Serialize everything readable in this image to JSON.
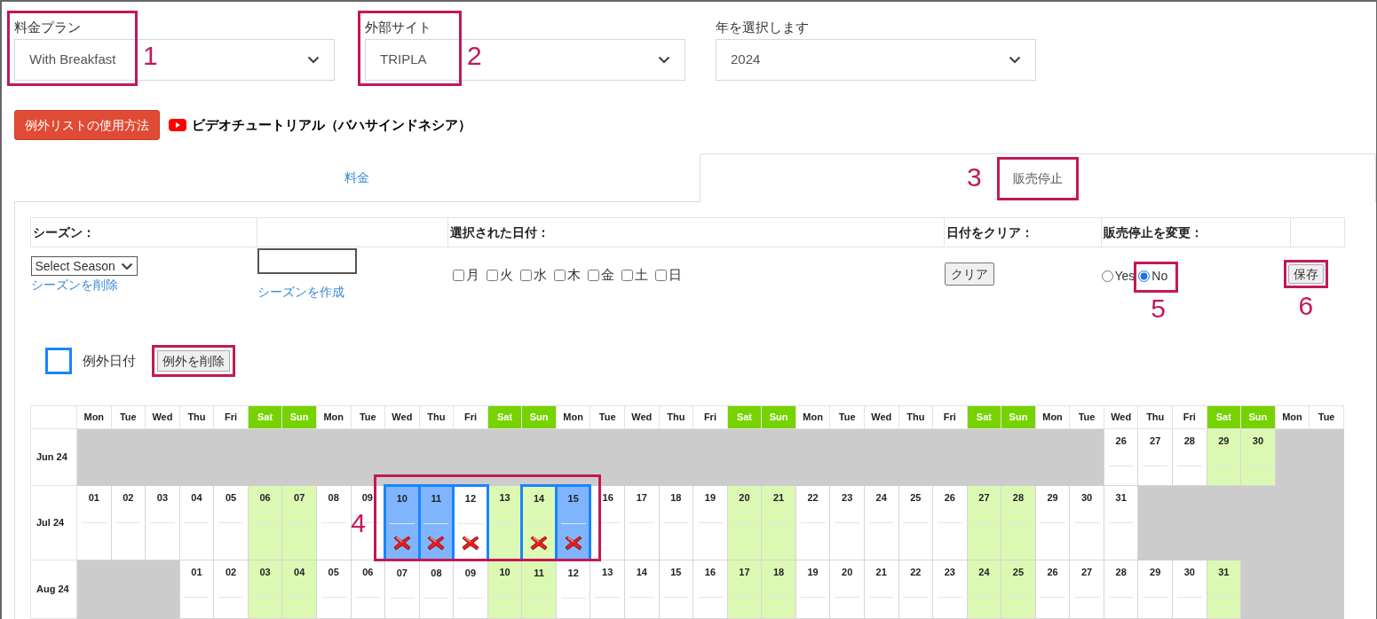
{
  "filters": [
    {
      "label": "料金プラン",
      "value": "With Breakfast",
      "callout": "1"
    },
    {
      "label": "外部サイト",
      "value": "TRIPLA",
      "callout": "2"
    },
    {
      "label": "年を選択します",
      "value": "2024"
    }
  ],
  "help_button": "例外リストの使用方法",
  "video_link": "ビデオチュートリアル（バハサインドネシア）",
  "tabs": [
    {
      "label": "料金",
      "selected": false
    },
    {
      "label": "販売停止",
      "selected": true,
      "callout": "3"
    }
  ],
  "season": {
    "header": "シーズン：",
    "select": "Select Season",
    "delete_link": "シーズンを削除",
    "create_link": "シーズンを作成"
  },
  "dates": {
    "header": "選択された日付：",
    "weekdays": [
      {
        "label": "月",
        "checked": false
      },
      {
        "label": "火",
        "checked": false
      },
      {
        "label": "水",
        "checked": false
      },
      {
        "label": "木",
        "checked": false
      },
      {
        "label": "金",
        "checked": false
      },
      {
        "label": "土",
        "checked": false
      },
      {
        "label": "日",
        "checked": false
      }
    ]
  },
  "clear": {
    "header": "日付をクリア：",
    "button": "クリア"
  },
  "stop_sale": {
    "header": "販売停止を変更：",
    "options": [
      {
        "label": "Yes",
        "selected": false
      },
      {
        "label": "No",
        "selected": true,
        "callout": "5"
      }
    ]
  },
  "save": {
    "label": "保存",
    "callout": "6"
  },
  "legend": {
    "label": "例外日付",
    "button": "例外を削除",
    "framed": true
  },
  "calendar": {
    "callout": "4",
    "columns": [
      {
        "label": "Mon",
        "weekend": false
      },
      {
        "label": "Tue",
        "weekend": false
      },
      {
        "label": "Wed",
        "weekend": false
      },
      {
        "label": "Thu",
        "weekend": false
      },
      {
        "label": "Fri",
        "weekend": false
      },
      {
        "label": "Sat",
        "weekend": true
      },
      {
        "label": "Sun",
        "weekend": true
      },
      {
        "label": "Mon",
        "weekend": false
      },
      {
        "label": "Tue",
        "weekend": false
      },
      {
        "label": "Wed",
        "weekend": false
      },
      {
        "label": "Thu",
        "weekend": false
      },
      {
        "label": "Fri",
        "weekend": false
      },
      {
        "label": "Sat",
        "weekend": true
      },
      {
        "label": "Sun",
        "weekend": true
      },
      {
        "label": "Mon",
        "weekend": false
      },
      {
        "label": "Tue",
        "weekend": false
      },
      {
        "label": "Wed",
        "weekend": false
      },
      {
        "label": "Thu",
        "weekend": false
      },
      {
        "label": "Fri",
        "weekend": false
      },
      {
        "label": "Sat",
        "weekend": true
      },
      {
        "label": "Sun",
        "weekend": true
      },
      {
        "label": "Mon",
        "weekend": false
      },
      {
        "label": "Tue",
        "weekend": false
      },
      {
        "label": "Wed",
        "weekend": false
      },
      {
        "label": "Thu",
        "weekend": false
      },
      {
        "label": "Fri",
        "weekend": false
      },
      {
        "label": "Sat",
        "weekend": true
      },
      {
        "label": "Sun",
        "weekend": true
      },
      {
        "label": "Mon",
        "weekend": false
      },
      {
        "label": "Tue",
        "weekend": false
      },
      {
        "label": "Wed",
        "weekend": false
      },
      {
        "label": "Thu",
        "weekend": false
      },
      {
        "label": "Fri",
        "weekend": false
      },
      {
        "label": "Sat",
        "weekend": true
      },
      {
        "label": "Sun",
        "weekend": true
      },
      {
        "label": "Mon",
        "weekend": false
      },
      {
        "label": "Tue",
        "weekend": false
      }
    ],
    "months": [
      {
        "label": "Jun 24",
        "cells": [
          {
            "kind": "blank"
          },
          {
            "kind": "blank"
          },
          {
            "kind": "blank"
          },
          {
            "kind": "blank"
          },
          {
            "kind": "blank"
          },
          {
            "kind": "blank"
          },
          {
            "kind": "blank"
          },
          {
            "kind": "blank"
          },
          {
            "kind": "blank"
          },
          {
            "kind": "blank"
          },
          {
            "kind": "blank"
          },
          {
            "kind": "blank"
          },
          {
            "kind": "blank"
          },
          {
            "kind": "blank"
          },
          {
            "kind": "blank"
          },
          {
            "kind": "blank"
          },
          {
            "kind": "blank"
          },
          {
            "kind": "blank"
          },
          {
            "kind": "blank"
          },
          {
            "kind": "blank"
          },
          {
            "kind": "blank"
          },
          {
            "kind": "blank"
          },
          {
            "kind": "blank"
          },
          {
            "kind": "blank"
          },
          {
            "kind": "blank"
          },
          {
            "kind": "blank"
          },
          {
            "kind": "blank"
          },
          {
            "kind": "blank"
          },
          {
            "kind": "blank"
          },
          {
            "kind": "blank"
          },
          {
            "kind": "day",
            "day": "26",
            "selected": false,
            "exception": false,
            "stop_sale": false
          },
          {
            "kind": "day",
            "day": "27",
            "selected": false,
            "exception": false,
            "stop_sale": false
          },
          {
            "kind": "day",
            "day": "28",
            "selected": false,
            "exception": false,
            "stop_sale": false
          },
          {
            "kind": "day",
            "day": "29",
            "selected": false,
            "exception": false,
            "stop_sale": false
          },
          {
            "kind": "day",
            "day": "30",
            "selected": false,
            "exception": false,
            "stop_sale": false
          }
        ]
      },
      {
        "label": "Jul 24",
        "cells": [
          {
            "kind": "day",
            "day": "01",
            "selected": false,
            "exception": false,
            "stop_sale": false
          },
          {
            "kind": "day",
            "day": "02",
            "selected": false,
            "exception": false,
            "stop_sale": false
          },
          {
            "kind": "day",
            "day": "03",
            "selected": false,
            "exception": false,
            "stop_sale": false
          },
          {
            "kind": "day",
            "day": "04",
            "selected": false,
            "exception": false,
            "stop_sale": false
          },
          {
            "kind": "day",
            "day": "05",
            "selected": false,
            "exception": false,
            "stop_sale": false
          },
          {
            "kind": "day",
            "day": "06",
            "selected": false,
            "exception": false,
            "stop_sale": false
          },
          {
            "kind": "day",
            "day": "07",
            "selected": false,
            "exception": false,
            "stop_sale": false
          },
          {
            "kind": "day",
            "day": "08",
            "selected": false,
            "exception": false,
            "stop_sale": false
          },
          {
            "kind": "day",
            "day": "09",
            "selected": false,
            "exception": false,
            "stop_sale": false
          },
          {
            "kind": "day",
            "day": "10",
            "selected": true,
            "exception": true,
            "stop_sale": true
          },
          {
            "kind": "day",
            "day": "11",
            "selected": true,
            "exception": true,
            "stop_sale": true
          },
          {
            "kind": "day",
            "day": "12",
            "selected": false,
            "exception": true,
            "stop_sale": true
          },
          {
            "kind": "day",
            "day": "13",
            "selected": false,
            "exception": false,
            "stop_sale": false
          },
          {
            "kind": "day",
            "day": "14",
            "selected": false,
            "exception": true,
            "stop_sale": true
          },
          {
            "kind": "day",
            "day": "15",
            "selected": true,
            "exception": true,
            "stop_sale": true
          },
          {
            "kind": "day",
            "day": "16",
            "selected": false,
            "exception": false,
            "stop_sale": false
          },
          {
            "kind": "day",
            "day": "17",
            "selected": false,
            "exception": false,
            "stop_sale": false
          },
          {
            "kind": "day",
            "day": "18",
            "selected": false,
            "exception": false,
            "stop_sale": false
          },
          {
            "kind": "day",
            "day": "19",
            "selected": false,
            "exception": false,
            "stop_sale": false
          },
          {
            "kind": "day",
            "day": "20",
            "selected": false,
            "exception": false,
            "stop_sale": false
          },
          {
            "kind": "day",
            "day": "21",
            "selected": false,
            "exception": false,
            "stop_sale": false
          },
          {
            "kind": "day",
            "day": "22",
            "selected": false,
            "exception": false,
            "stop_sale": false
          },
          {
            "kind": "day",
            "day": "23",
            "selected": false,
            "exception": false,
            "stop_sale": false
          },
          {
            "kind": "day",
            "day": "24",
            "selected": false,
            "exception": false,
            "stop_sale": false
          },
          {
            "kind": "day",
            "day": "25",
            "selected": false,
            "exception": false,
            "stop_sale": false
          },
          {
            "kind": "day",
            "day": "26",
            "selected": false,
            "exception": false,
            "stop_sale": false
          },
          {
            "kind": "day",
            "day": "27",
            "selected": false,
            "exception": false,
            "stop_sale": false
          },
          {
            "kind": "day",
            "day": "28",
            "selected": false,
            "exception": false,
            "stop_sale": false
          },
          {
            "kind": "day",
            "day": "29",
            "selected": false,
            "exception": false,
            "stop_sale": false
          },
          {
            "kind": "day",
            "day": "30",
            "selected": false,
            "exception": false,
            "stop_sale": false
          },
          {
            "kind": "day",
            "day": "31",
            "selected": false,
            "exception": false,
            "stop_sale": false
          }
        ]
      },
      {
        "label": "Aug 24",
        "cells": [
          {
            "kind": "blank"
          },
          {
            "kind": "blank"
          },
          {
            "kind": "blank"
          },
          {
            "kind": "day",
            "day": "01",
            "selected": false,
            "exception": false,
            "stop_sale": false
          },
          {
            "kind": "day",
            "day": "02",
            "selected": false,
            "exception": false,
            "stop_sale": false
          },
          {
            "kind": "day",
            "day": "03",
            "selected": false,
            "exception": false,
            "stop_sale": false
          },
          {
            "kind": "day",
            "day": "04",
            "selected": false,
            "exception": false,
            "stop_sale": false
          },
          {
            "kind": "day",
            "day": "05",
            "selected": false,
            "exception": false,
            "stop_sale": false
          },
          {
            "kind": "day",
            "day": "06",
            "selected": false,
            "exception": false,
            "stop_sale": false
          },
          {
            "kind": "day",
            "day": "07",
            "selected": false,
            "exception": false,
            "stop_sale": false
          },
          {
            "kind": "day",
            "day": "08",
            "selected": false,
            "exception": false,
            "stop_sale": false
          },
          {
            "kind": "day",
            "day": "09",
            "selected": false,
            "exception": false,
            "stop_sale": false
          },
          {
            "kind": "day",
            "day": "10",
            "selected": false,
            "exception": false,
            "stop_sale": false
          },
          {
            "kind": "day",
            "day": "11",
            "selected": false,
            "exception": false,
            "stop_sale": false
          },
          {
            "kind": "day",
            "day": "12",
            "selected": false,
            "exception": false,
            "stop_sale": false
          },
          {
            "kind": "day",
            "day": "13",
            "selected": false,
            "exception": false,
            "stop_sale": false
          },
          {
            "kind": "day",
            "day": "14",
            "selected": false,
            "exception": false,
            "stop_sale": false
          },
          {
            "kind": "day",
            "day": "15",
            "selected": false,
            "exception": false,
            "stop_sale": false
          },
          {
            "kind": "day",
            "day": "16",
            "selected": false,
            "exception": false,
            "stop_sale": false
          },
          {
            "kind": "day",
            "day": "17",
            "selected": false,
            "exception": false,
            "stop_sale": false
          },
          {
            "kind": "day",
            "day": "18",
            "selected": false,
            "exception": false,
            "stop_sale": false
          },
          {
            "kind": "day",
            "day": "19",
            "selected": false,
            "exception": false,
            "stop_sale": false
          },
          {
            "kind": "day",
            "day": "20",
            "selected": false,
            "exception": false,
            "stop_sale": false
          },
          {
            "kind": "day",
            "day": "21",
            "selected": false,
            "exception": false,
            "stop_sale": false
          },
          {
            "kind": "day",
            "day": "22",
            "selected": false,
            "exception": false,
            "stop_sale": false
          },
          {
            "kind": "day",
            "day": "23",
            "selected": false,
            "exception": false,
            "stop_sale": false
          },
          {
            "kind": "day",
            "day": "24",
            "selected": false,
            "exception": false,
            "stop_sale": false
          },
          {
            "kind": "day",
            "day": "25",
            "selected": false,
            "exception": false,
            "stop_sale": false
          },
          {
            "kind": "day",
            "day": "26",
            "selected": false,
            "exception": false,
            "stop_sale": false
          },
          {
            "kind": "day",
            "day": "27",
            "selected": false,
            "exception": false,
            "stop_sale": false
          },
          {
            "kind": "day",
            "day": "28",
            "selected": false,
            "exception": false,
            "stop_sale": false
          },
          {
            "kind": "day",
            "day": "29",
            "selected": false,
            "exception": false,
            "stop_sale": false
          },
          {
            "kind": "day",
            "day": "30",
            "selected": false,
            "exception": false,
            "stop_sale": false
          },
          {
            "kind": "day",
            "day": "31",
            "selected": false,
            "exception": false,
            "stop_sale": false
          }
        ]
      }
    ]
  }
}
